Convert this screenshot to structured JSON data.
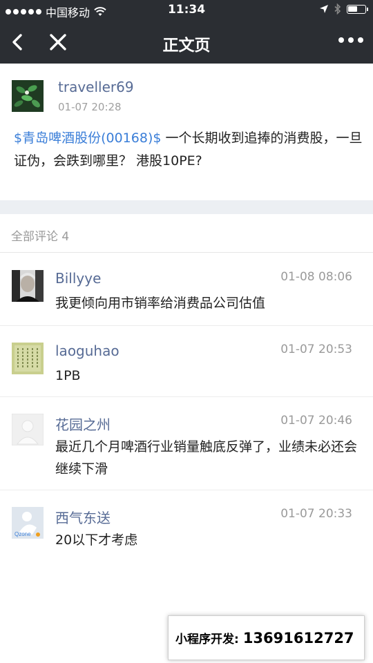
{
  "status_bar": {
    "carrier": "中国移动",
    "time": "11:34",
    "signal_dots": 5,
    "battery_level": 0.55
  },
  "nav": {
    "title": "正文页",
    "back_icon": "back-arrow-icon",
    "close_icon": "close-icon",
    "more_icon": "more-dots-icon"
  },
  "post": {
    "author": "traveller69",
    "time": "01-07 20:28",
    "stock_tag": "$青岛啤酒股份(00168)$",
    "text": " 一个长期收到追捧的消费股，一旦证伪，会跌到哪里？ 港股10PE?"
  },
  "comments_header": "全部评论 4",
  "comments": [
    {
      "name": "Billyye",
      "time": "01-08 08:06",
      "text": "我更倾向用市销率给消费品公司估值"
    },
    {
      "name": "laoguhao",
      "time": "01-07 20:53",
      "text": "1PB"
    },
    {
      "name": "花园之州",
      "time": "01-07 20:46",
      "text": "最近几个月啤酒行业销量触底反弹了，业绩未必还会继续下滑"
    },
    {
      "name": "西气东送",
      "time": "01-07 20:33",
      "text": "20以下才考虑"
    }
  ],
  "banner": {
    "label": "小程序开发:",
    "phone": "13691612727"
  }
}
